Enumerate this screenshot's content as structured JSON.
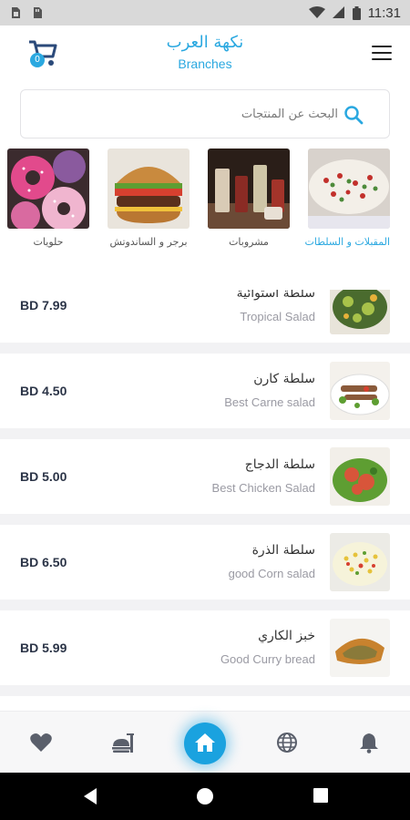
{
  "status_bar": {
    "time": "11:31"
  },
  "header": {
    "brand_ar": "نكهة العرب",
    "brand_en": "Branches",
    "cart_count": "0"
  },
  "search": {
    "placeholder": "البحث عن المنتجات"
  },
  "categories": [
    {
      "label": "المقبلات و السلطات",
      "active": true
    },
    {
      "label": "مشروبات",
      "active": false
    },
    {
      "label": "برجر و الساندوتش",
      "active": false
    },
    {
      "label": "حلويات",
      "active": false
    }
  ],
  "products": [
    {
      "name_ar": "سلطة استوائية",
      "name_en": "Tropical Salad",
      "price": "BD 7.99"
    },
    {
      "name_ar": "سلطة كارن",
      "name_en": "Best Carne salad",
      "price": "BD 4.50"
    },
    {
      "name_ar": "سلطة الدجاج",
      "name_en": "Best Chicken Salad",
      "price": "BD 5.00"
    },
    {
      "name_ar": "سلطة الذرة",
      "name_en": "good Corn salad",
      "price": "BD 6.50"
    },
    {
      "name_ar": "خبز الكاري",
      "name_en": "Good Curry bread",
      "price": "BD 5.99"
    }
  ],
  "bottom_nav": [
    "heart-icon",
    "food-icon",
    "home-icon",
    "globe-icon",
    "bell-icon"
  ],
  "colors": {
    "accent": "#2aa8e0",
    "price": "#2b3447"
  }
}
